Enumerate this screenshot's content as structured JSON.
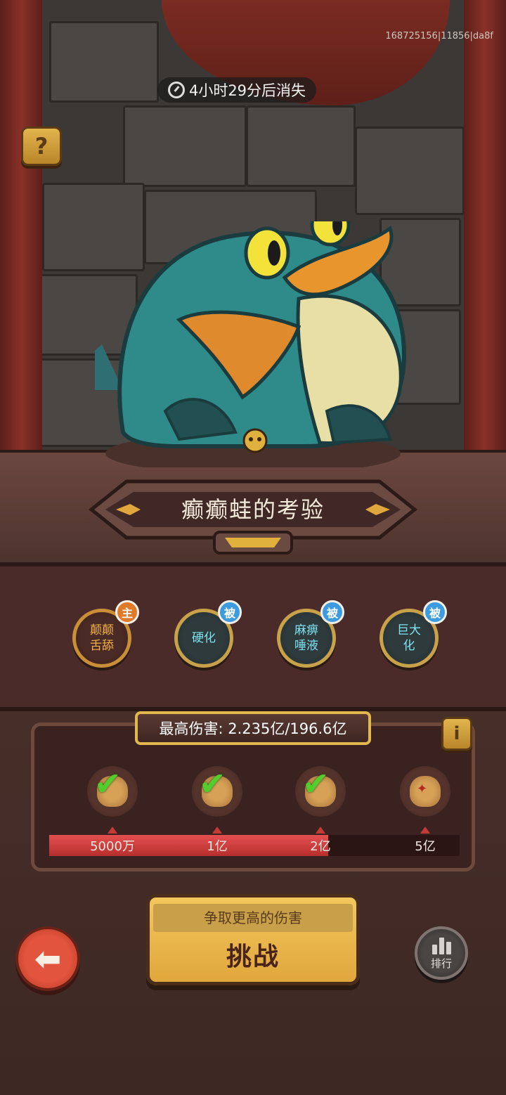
{
  "build_id": "168725156|11856|da8f",
  "timer": {
    "text": "4小时29分后消失",
    "icon": "clock-icon"
  },
  "help": {
    "icon": "question-icon",
    "label": "?"
  },
  "boss": {
    "title": "癫癫蛙的考验"
  },
  "skills": [
    {
      "label": "颠颠\n舌舔",
      "badge": "主",
      "type": "main"
    },
    {
      "label": "硬化",
      "badge": "被",
      "type": "passive"
    },
    {
      "label": "麻痹\n唾液",
      "badge": "被",
      "type": "passive"
    },
    {
      "label": "巨大\n化",
      "badge": "被",
      "type": "passive"
    }
  ],
  "damage": {
    "label": "最高伤害: 2.235亿/196.6亿",
    "info_label": "i",
    "progress_fraction": 0.68
  },
  "rewards": [
    {
      "threshold": "5000万",
      "claimed": true
    },
    {
      "threshold": "1亿",
      "claimed": true
    },
    {
      "threshold": "2亿",
      "claimed": true
    },
    {
      "threshold": "5亿",
      "claimed": false
    }
  ],
  "challenge": {
    "subtitle": "争取更高的伤害",
    "label": "挑战"
  },
  "rank": {
    "label": "排行",
    "icon": "bar-chart-icon"
  },
  "back": {
    "icon": "back-arrow-icon"
  },
  "colors": {
    "gold": "#e1b74e",
    "progress": "#d9413f",
    "passive_badge": "#3d9ce0",
    "main_badge": "#e07a28"
  }
}
